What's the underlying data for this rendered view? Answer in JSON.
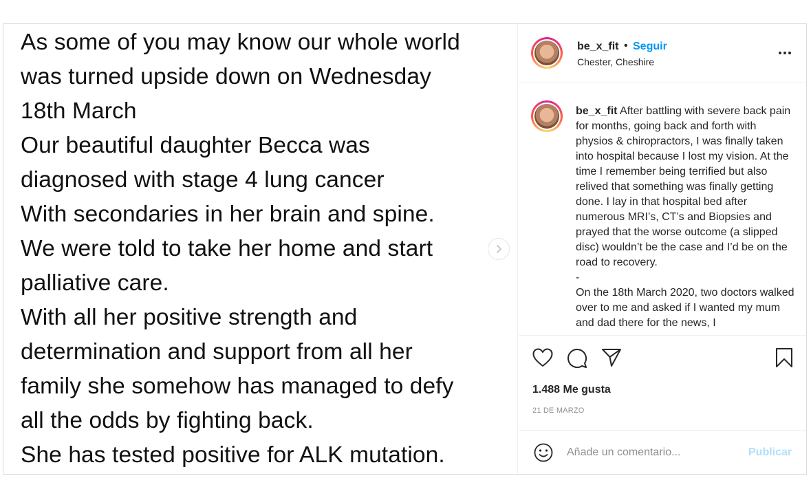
{
  "media": {
    "lines": [
      "As some of you may know our whole world",
      "was turned upside down on Wednesday",
      "18th March",
      "Our beautiful daughter Becca was",
      "diagnosed with stage 4 lung cancer",
      "With secondaries in her brain and spine.",
      "We were told to take her home and start",
      "palliative care.",
      "With all her positive strength and",
      "determination and support from all her",
      "family she somehow has managed to defy",
      "all the odds by fighting back.",
      "She has tested positive for ALK mutation."
    ],
    "next_icon": "chevron-right-icon"
  },
  "header": {
    "username": "be_x_fit",
    "separator": "•",
    "follow_label": "Seguir",
    "location": "Chester, Cheshire",
    "more_icon": "more-options-icon"
  },
  "caption": {
    "username": "be_x_fit",
    "paragraphs": [
      "After battling with severe back pain for months, going back and forth with physios & chiropractors, I was finally taken into hospital because I lost my vision. At the time I remember being terrified but also relived that something was finally getting done. I lay in that hospital bed after numerous MRI’s, CT’s and Biopsies and prayed that the worse outcome (a slipped disc) wouldn’t be the case and I’d be on the road to recovery.",
      "-",
      "On the 18th March 2020, two doctors walked over to me and asked if I wanted my mum and dad there for the news, I"
    ]
  },
  "actions": {
    "like_icon": "heart-icon",
    "comment_icon": "comment-icon",
    "share_icon": "paper-plane-icon",
    "save_icon": "bookmark-icon",
    "likes_text": "1.488 Me gusta",
    "date_text": "21 DE MARZO"
  },
  "comment_form": {
    "emoji_icon": "smiley-icon",
    "placeholder": "Añade un comentario...",
    "publish_label": "Publicar"
  },
  "colors": {
    "link_blue": "#0095f6",
    "publish_disabled": "#b2dffc",
    "muted_text": "#8e8e8e",
    "border": "#dbdbdb"
  }
}
